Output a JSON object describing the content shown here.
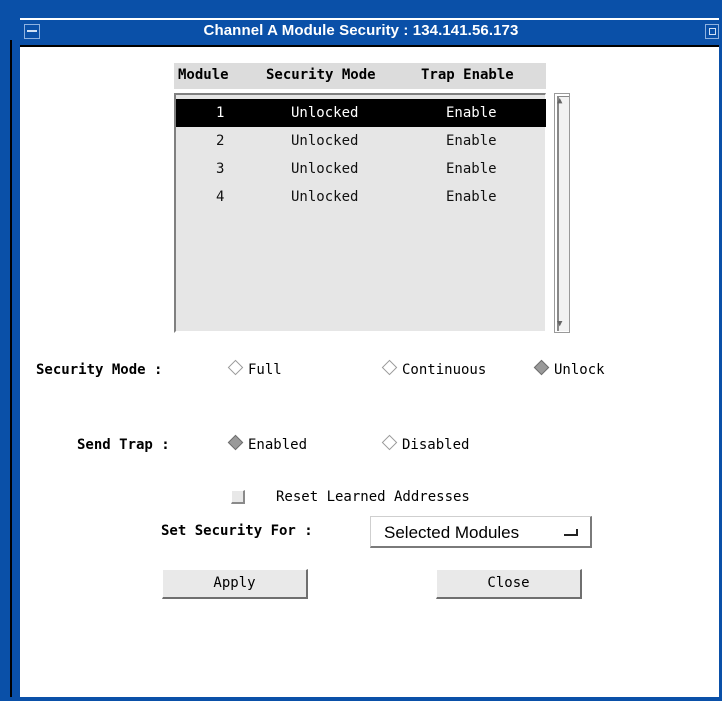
{
  "window": {
    "title": "Channel A Module Security : 134.141.56.173"
  },
  "table": {
    "headers": [
      "Module",
      "Security Mode",
      "Trap Enable"
    ],
    "rows": [
      {
        "module": "1",
        "mode": "Unlocked",
        "trap": "Enable",
        "selected": true
      },
      {
        "module": "2",
        "mode": "Unlocked",
        "trap": "Enable",
        "selected": false
      },
      {
        "module": "3",
        "mode": "Unlocked",
        "trap": "Enable",
        "selected": false
      },
      {
        "module": "4",
        "mode": "Unlocked",
        "trap": "Enable",
        "selected": false
      }
    ]
  },
  "security_mode": {
    "label": "Security Mode :",
    "options": [
      "Full",
      "Continuous",
      "Unlock"
    ],
    "selected": "Unlock"
  },
  "send_trap": {
    "label": "Send Trap :",
    "options": [
      "Enabled",
      "Disabled"
    ],
    "selected": "Enabled"
  },
  "reset": {
    "label": "Reset Learned Addresses",
    "checked": false
  },
  "set_security": {
    "label": "Set Security For :",
    "value": "Selected Modules"
  },
  "buttons": {
    "apply": "Apply",
    "close": "Close"
  },
  "colors": {
    "titlebar": "#0a50a8",
    "selection": "#000000"
  }
}
